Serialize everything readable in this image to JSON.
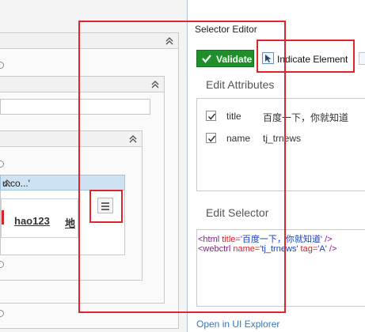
{
  "workflow": {
    "target_label": "u.co...'",
    "preview_links": [
      "hao123",
      "地"
    ]
  },
  "selector_editor": {
    "title": "Selector Editor",
    "validate_label": "Validate",
    "indicate_label": "Indicate Element",
    "edit_attributes_label": "Edit Attributes",
    "attributes": [
      {
        "name": "title",
        "value": "百度一下，你就知道",
        "checked": true
      },
      {
        "name": "name",
        "value": "tj_trnews",
        "checked": true
      }
    ],
    "edit_selector_label": "Edit Selector",
    "selector_lines": [
      {
        "tag_open": "<html ",
        "parts": [
          {
            "attr": "title=",
            "val": "'百度一下，你就知道'"
          }
        ],
        "tag_close": " />"
      },
      {
        "tag_open": "<webctrl ",
        "parts": [
          {
            "attr": "name=",
            "val": "'tj_trnews'"
          },
          {
            "attr": " tag=",
            "val": "'A'"
          }
        ],
        "tag_close": " />"
      }
    ],
    "open_in_explorer_label": "Open in UI Explorer"
  },
  "colors": {
    "validate_bg": "#1f8f2c",
    "annotation_red": "#e0262c",
    "selector_tag": "#8a1a8a",
    "selector_attr": "#d8232a",
    "selector_value": "#1a3fbf",
    "link": "#3b76b8"
  },
  "icons": {
    "collapse": "chevron-double-up-icon",
    "indicate": "cursor-select-icon",
    "menu": "hamburger-menu-icon",
    "checkbox": "checkmark-icon"
  }
}
